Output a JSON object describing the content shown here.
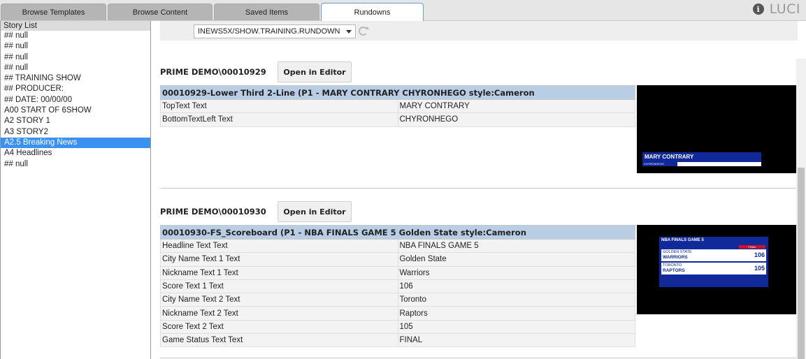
{
  "tabs": [
    {
      "label": "Browse Templates"
    },
    {
      "label": "Browse Content"
    },
    {
      "label": "Saved Items"
    },
    {
      "label": "Rundowns"
    }
  ],
  "brand": {
    "info_icon": "i",
    "name": "LUCI"
  },
  "story_panel": {
    "header": "Story List",
    "items": [
      {
        "label": "## null"
      },
      {
        "label": "## null"
      },
      {
        "label": "## null"
      },
      {
        "label": "## null"
      },
      {
        "label": "## TRAINING SHOW"
      },
      {
        "label": "## PRODUCER:"
      },
      {
        "label": "## DATE: 00/00/00"
      },
      {
        "label": "A00 START OF 6SHOW"
      },
      {
        "label": "A2 STORY 1"
      },
      {
        "label": "A3 STORY2"
      },
      {
        "label": "A2.5 Breaking News"
      },
      {
        "label": "A4 Headlines"
      },
      {
        "label": "## null"
      }
    ],
    "selected_index": 10
  },
  "toolbar": {
    "rundown": "INEWS5X/SHOW.TRAINING.RUNDOWN"
  },
  "sections": [
    {
      "title": "PRIME DEMO\\00010929",
      "button": "Open in Editor",
      "table_header": "00010929-Lower Third 2-Line (P1 - MARY CONTRARY CHYRONHEGO style:Cameron",
      "rows": [
        [
          "TopText Text",
          "MARY CONTRARY"
        ],
        [
          "BottomTextLeft Text",
          "CHYRONHEGO"
        ]
      ],
      "preview": {
        "line1": "MARY CONTRARY",
        "line2": "CHYRONHEGO"
      }
    },
    {
      "title": "PRIME DEMO\\00010930",
      "button": "Open in Editor",
      "table_header": "00010930-FS_Scoreboard (P1 - NBA FINALS GAME 5 Golden State style:Cameron",
      "rows": [
        [
          "Headline Text Text",
          "NBA FINALS GAME 5"
        ],
        [
          "City Name Text 1 Text",
          "Golden State"
        ],
        [
          "Nickname Text 1 Text",
          "Warriors"
        ],
        [
          "Score Text 1 Text",
          "106"
        ],
        [
          "City Name Text 2 Text",
          "Toronto"
        ],
        [
          "Nickname Text 2 Text",
          "Raptors"
        ],
        [
          "Score Text 2 Text",
          "105"
        ],
        [
          "Game Status Text Text",
          "FINAL"
        ]
      ],
      "preview": {
        "headline": "NBA FINALS GAME 5",
        "status": "FINAL",
        "team1_city": "GOLDEN STATE",
        "team1_nick": "WARRIORS",
        "team1_score": "106",
        "team2_city": "TORONTO",
        "team2_nick": "RAPTORS",
        "team2_score": "105"
      }
    }
  ]
}
